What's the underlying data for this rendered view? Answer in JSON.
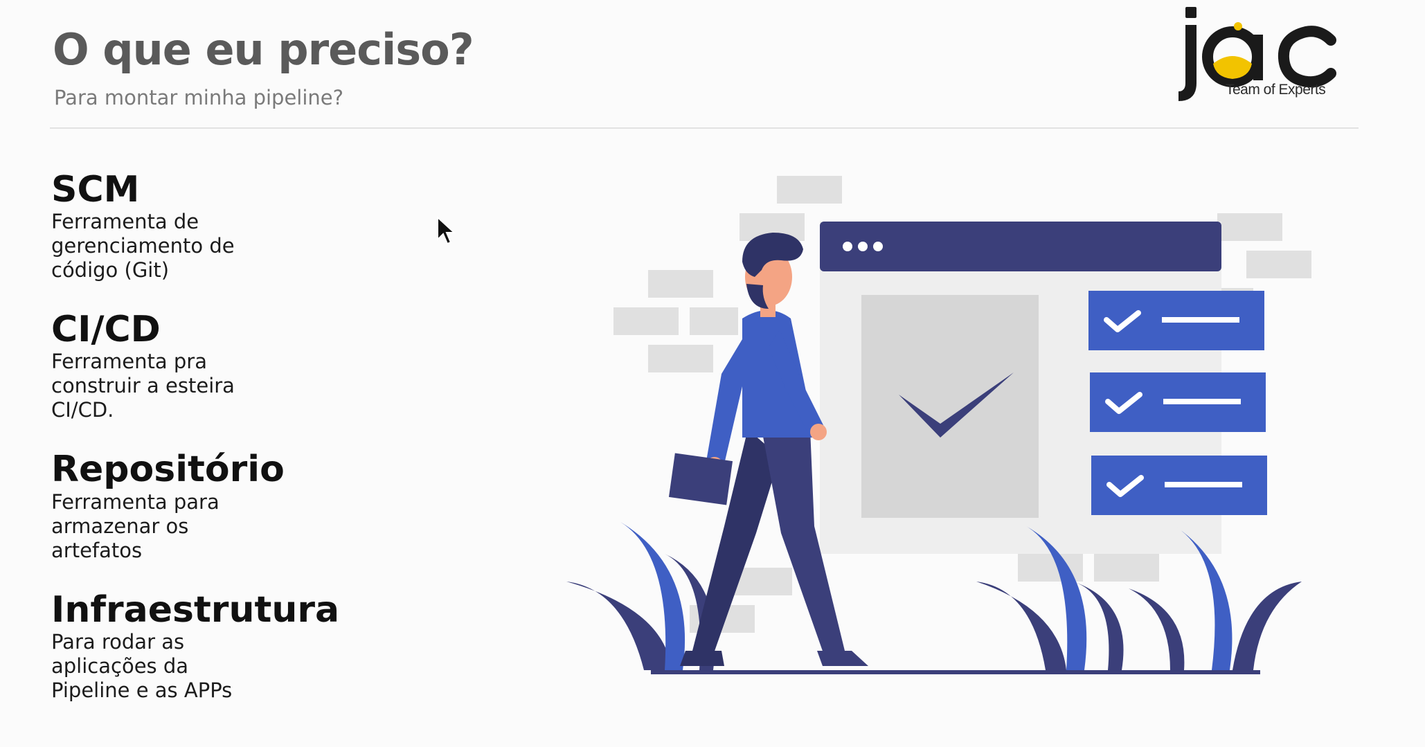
{
  "slide": {
    "title": "O que eu preciso?",
    "subtitle": "Para montar minha pipeline?"
  },
  "logo": {
    "brand": "jac",
    "tagline": "Team of Experts",
    "brand_color": "#1a1a1a",
    "accent_color": "#f2c300"
  },
  "items": [
    {
      "title": "SCM",
      "description": "Ferramenta de\ngerenciamento de\ncódigo (Git)"
    },
    {
      "title": "CI/CD",
      "description": "Ferramenta pra\nconstruir a esteira\nCI/CD."
    },
    {
      "title": "Repositório",
      "description": "Ferramenta para\narmazenar os\nartefatos"
    },
    {
      "title": "Infraestrutura",
      "description": "Para rodar as\naplicações da\nPipeline e as APPs"
    }
  ],
  "illustration": {
    "subject": "person-walking-past-checklist",
    "primary_color": "#3f5fc4",
    "dark_color": "#3b3f7a",
    "skin_color": "#f4a484",
    "wall_color": "#e0e0e0"
  },
  "cursor": {
    "icon": "arrow-pointer-icon"
  }
}
